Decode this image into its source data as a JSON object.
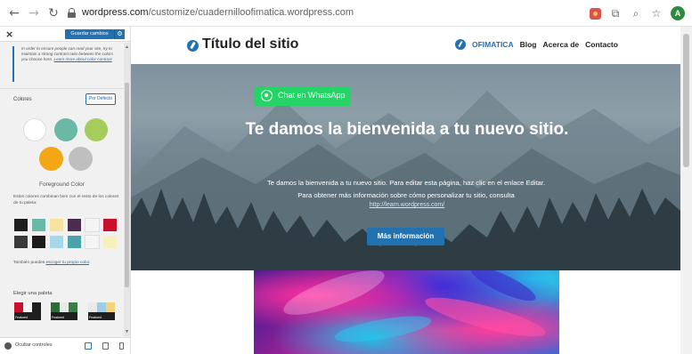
{
  "browser": {
    "url_host": "wordpress.com",
    "url_path": "/customize/cuadernilloofimatica.wordpress.com",
    "profile_initial": "A"
  },
  "sidebar": {
    "save_label": "Guardar cambios",
    "notice_text": "In order to ensure people can read your site, try to maintain a strong contrast ratio between the colors you choose here.",
    "notice_link": "Learn more about color contrast",
    "colors_label": "Colores",
    "default_label": "Por Defecto",
    "swatches": [
      "#ffffff",
      "#6ab8a6",
      "#a6cd5c",
      "#f3a715",
      "#bfbfbf"
    ],
    "foreground_label": "Foreground Color",
    "colors_desc": "Estos colores combinan bien con el resto de los colores de tu paleta:",
    "grid_colors": [
      "#1e1e1e",
      "#6ab8a6",
      "#f7e3a0",
      "#4b2c4f",
      "#f4f4f4",
      "#c8102e",
      "#3a3a3a",
      "#1c1c1c",
      "#a6d8ea",
      "#4aa3a8",
      "#f4f4f4",
      "#f6efc0"
    ],
    "own_color_text": "También puedes",
    "own_color_link": "escoger tu propio color",
    "palette_label": "Elegir una paleta",
    "palette_tag": "Featured",
    "hide_controls": "Ocultar controles"
  },
  "site": {
    "title": "Título del sitio",
    "menu": [
      "OFIMATICA",
      "Blog",
      "Acerca de",
      "Contacto"
    ],
    "whatsapp_label": "Chat en WhatsApp",
    "hero_title": "Te damos la bienvenida a tu nuevo sitio.",
    "hero_text_1": "Te damos la bienvenida a tu nuevo sitio. Para editar esta página, haz clic en el enlace Editar.",
    "hero_text_2": "Para obtener más información sobre cómo personalizar tu sitio, consulta",
    "hero_link": "http://learn.wordpress.com/",
    "hero_button": "Más información"
  },
  "colors": {
    "accent": "#2271b1",
    "whatsapp": "#25d366"
  }
}
